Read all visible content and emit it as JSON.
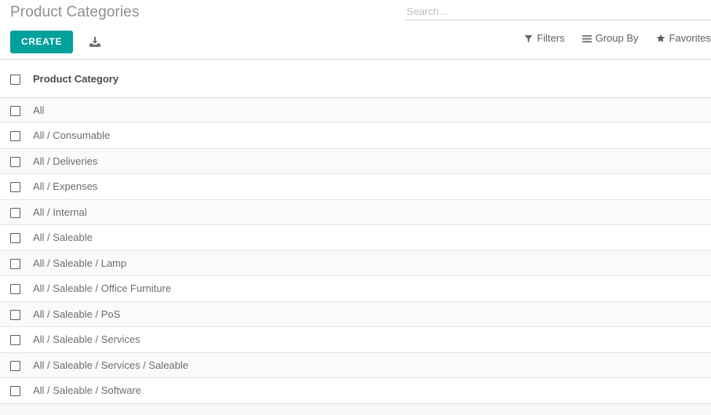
{
  "control_panel": {
    "breadcrumb": "Product Categories",
    "create_label": "CREATE",
    "import_icon": "import-download-icon"
  },
  "search": {
    "placeholder": "Search...",
    "value": ""
  },
  "filter_bar": {
    "items": [
      {
        "label": "Filters",
        "icon": "funnel-icon"
      },
      {
        "label": "Group By",
        "icon": "hamburger-icon"
      },
      {
        "label": "Favorites",
        "icon": "star-icon"
      }
    ]
  },
  "list": {
    "columns": [
      "Product Category"
    ],
    "select_all": "",
    "rows": [
      {
        "name": "All"
      },
      {
        "name": "All / Consumable"
      },
      {
        "name": "All / Deliveries"
      },
      {
        "name": "All / Expenses"
      },
      {
        "name": "All / Internal"
      },
      {
        "name": "All / Saleable"
      },
      {
        "name": "All / Saleable / Lamp"
      },
      {
        "name": "All / Saleable / Office Furniture"
      },
      {
        "name": "All / Saleable / PoS"
      },
      {
        "name": "All / Saleable / Services"
      },
      {
        "name": "All / Saleable / Services / Saleable"
      },
      {
        "name": "All / Saleable / Software"
      }
    ]
  },
  "colors": {
    "accent": "#00a09d",
    "text_muted": "#6d6d6d",
    "title": "#8f8f8f",
    "row_stripe": "#fafafa",
    "border": "#d8d8e0"
  }
}
